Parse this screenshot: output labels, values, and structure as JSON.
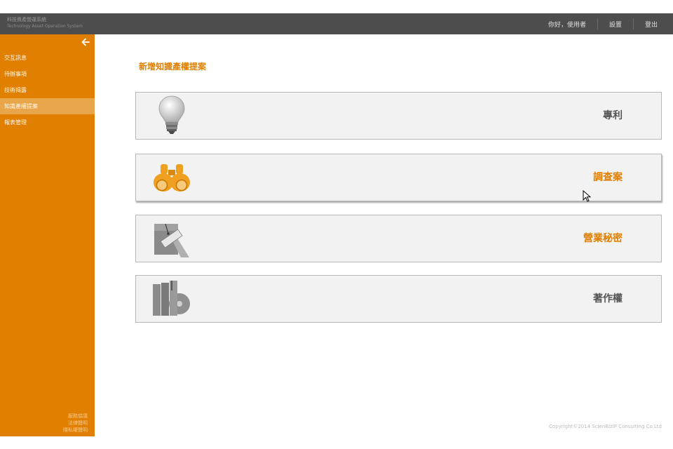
{
  "header": {
    "system_name_zh": "科技資產營運系統",
    "system_name_en": "Technology Asset Operation System",
    "greeting": "你好，使用者",
    "settings": "設置",
    "logout": "登出"
  },
  "sidebar": {
    "items": [
      {
        "label": "交互訊息"
      },
      {
        "label": "待辦事項"
      },
      {
        "label": "技術揭露"
      },
      {
        "label": "知識產權提案",
        "active": true
      },
      {
        "label": "報表管理"
      }
    ],
    "footer": [
      "服務協議",
      "法律聲明",
      "隱私權聲明"
    ]
  },
  "main": {
    "title": "新增知識產權提案",
    "cards": [
      {
        "label": "專利",
        "icon": "lightbulb-icon",
        "label_color": "#555555"
      },
      {
        "label": "調查案",
        "icon": "binoculars-icon",
        "label_color": "#e07f00"
      },
      {
        "label": "營業秘密",
        "icon": "confidential-folder-icon",
        "label_color": "#e07f00"
      },
      {
        "label": "著作權",
        "icon": "books-disc-icon",
        "label_color": "#555555"
      }
    ],
    "copyright": "Copyright©2014 ScienBizIP Consulting Co.Ltd"
  },
  "colors": {
    "accent": "#e07f00",
    "topbar": "#4d4d4d",
    "sidebar_active": "#e9a54a"
  }
}
